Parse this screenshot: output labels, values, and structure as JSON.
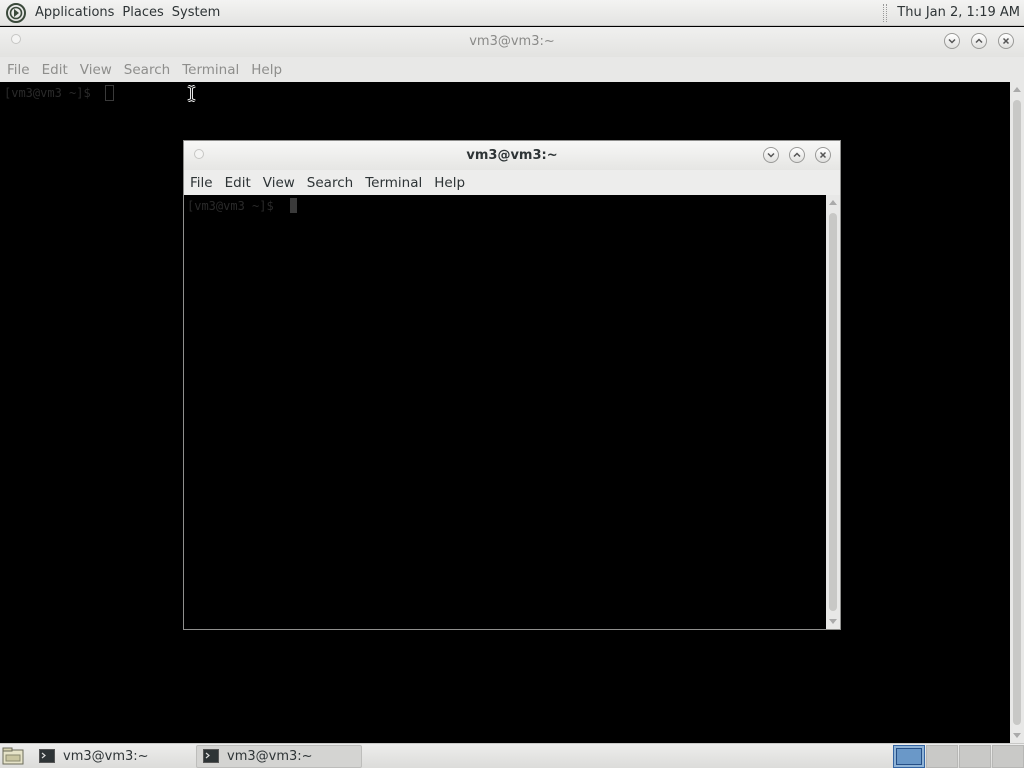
{
  "top_panel": {
    "menus": [
      "Applications",
      "Places",
      "System"
    ],
    "clock": "Thu Jan  2,  1:19 AM"
  },
  "back_terminal": {
    "title": "vm3@vm3:~",
    "menu": [
      "File",
      "Edit",
      "View",
      "Search",
      "Terminal",
      "Help"
    ],
    "prompt": "[vm3@vm3 ~]$"
  },
  "front_terminal": {
    "title": "vm3@vm3:~",
    "menu": [
      "File",
      "Edit",
      "View",
      "Search",
      "Terminal",
      "Help"
    ],
    "prompt": "[vm3@vm3 ~]$"
  },
  "taskbar": {
    "tasks": [
      {
        "label": "vm3@vm3:~",
        "active": false
      },
      {
        "label": "vm3@vm3:~",
        "active": true
      }
    ],
    "workspaces": 4,
    "current_workspace": 1
  },
  "icons": {
    "window_minimize": "chevron-down-icon",
    "window_maximize": "chevron-up-icon",
    "window_close": "close-icon"
  },
  "colors": {
    "terminal_bg": "#000000",
    "panel_bg": "#e8e8e7",
    "accent": "#3465a4"
  }
}
